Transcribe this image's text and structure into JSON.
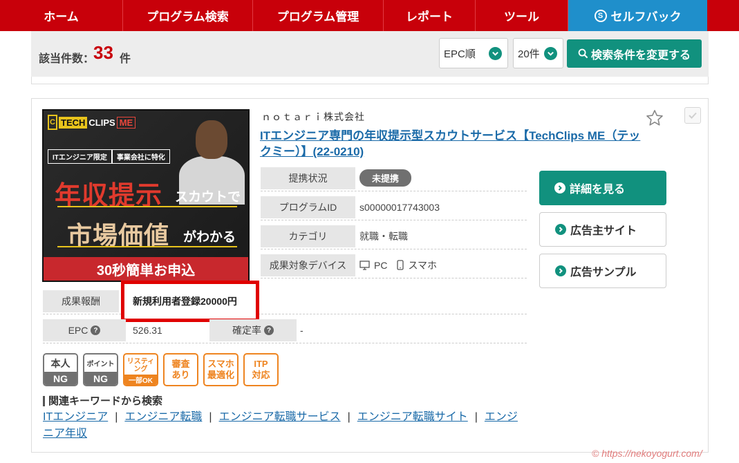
{
  "nav": {
    "items": [
      "ホーム",
      "プログラム検索",
      "プログラム管理",
      "レポート",
      "ツール"
    ],
    "self_back": "セルフバック",
    "self_back_icon": "S"
  },
  "results": {
    "label": "該当件数：",
    "count": "33",
    "unit": "件",
    "sort": "EPC順",
    "per_page": "20件",
    "change_button": "検索条件を変更する"
  },
  "program": {
    "company": "ｎｏｔａｒｉ株式会社",
    "title": "ITエンジニア専門の年収提示型スカウトサービス【TechClips ME（テックミー）】(22-0210)",
    "banner": {
      "logo_c": "C",
      "logo_tech": "TECH",
      "logo_clips": "CLIPS",
      "logo_me": "ME",
      "tag1": "ITエンジニア限定",
      "tag2": "事業会社に特化",
      "line1_big": "年収提示",
      "line1_small": "スカウトで",
      "line2_big": "市場価値",
      "line2_small": "がわかる",
      "cta": "30秒簡単お申込"
    },
    "fields": {
      "status_label": "提携状況",
      "status_value": "未提携",
      "id_label": "プログラムID",
      "id_value": "s00000017743003",
      "category_label": "カテゴリ",
      "category_value": "就職・転職",
      "device_label": "成果対象デバイス",
      "device_pc": "PC",
      "device_sp": "スマホ",
      "reward_label": "成果報酬",
      "reward_value": "新規利用者登録20000円",
      "epc_label": "EPC",
      "epc_value": "526.31",
      "rate_label": "確定率",
      "rate_value": "-",
      "help_icon": "?"
    },
    "buttons": {
      "detail": "詳細を見る",
      "advertiser": "広告主サイト",
      "sample": "広告サンプル"
    },
    "conditions": [
      {
        "top": "本人",
        "bottom": "NG"
      },
      {
        "top": "ポイント",
        "bottom": "NG"
      },
      {
        "top": "リスティング",
        "bottom": "一部OK"
      },
      {
        "line1": "審査",
        "line2": "あり"
      },
      {
        "line1": "スマホ",
        "line2": "最適化"
      },
      {
        "line1": "ITP",
        "line2": "対応"
      }
    ],
    "keywords": {
      "heading": "関連キーワードから検索",
      "items": [
        "ITエンジニア",
        "エンジニア転職",
        "エンジニア転職サービス",
        "エンジニア転職サイト",
        "エンジニア年収"
      ],
      "separator": "|"
    }
  },
  "watermark": "© https://nekoyogurt.com/",
  "colors": {
    "nav": "#c8000a",
    "selfback": "#1f8fcb",
    "accent": "#11917e",
    "count": "#c8000a",
    "highlight_border": "#e00000",
    "condition_orange": "#ee8420"
  }
}
